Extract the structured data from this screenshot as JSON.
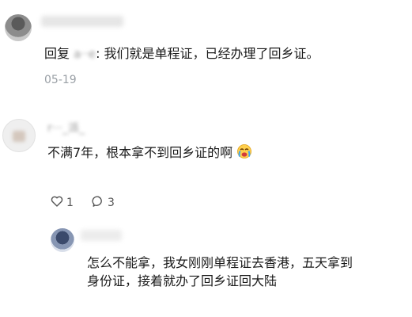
{
  "reply1": {
    "reply_prefix": "回复",
    "reply_to": "a··e",
    "text": ": 我们就是单程证，已经办理了回乡证。",
    "date": "05-19"
  },
  "comment2": {
    "username": "r···_派_",
    "text": "不满7年，根本拿不到回乡证的啊",
    "emoji_icon": "crying-face-icon",
    "likes": "1",
    "replies": "3"
  },
  "reply2": {
    "line1": "怎么不能拿，我女刚刚单程证去香港，五天拿到",
    "line2": "身份证，接着就办了回乡证回大陆"
  }
}
